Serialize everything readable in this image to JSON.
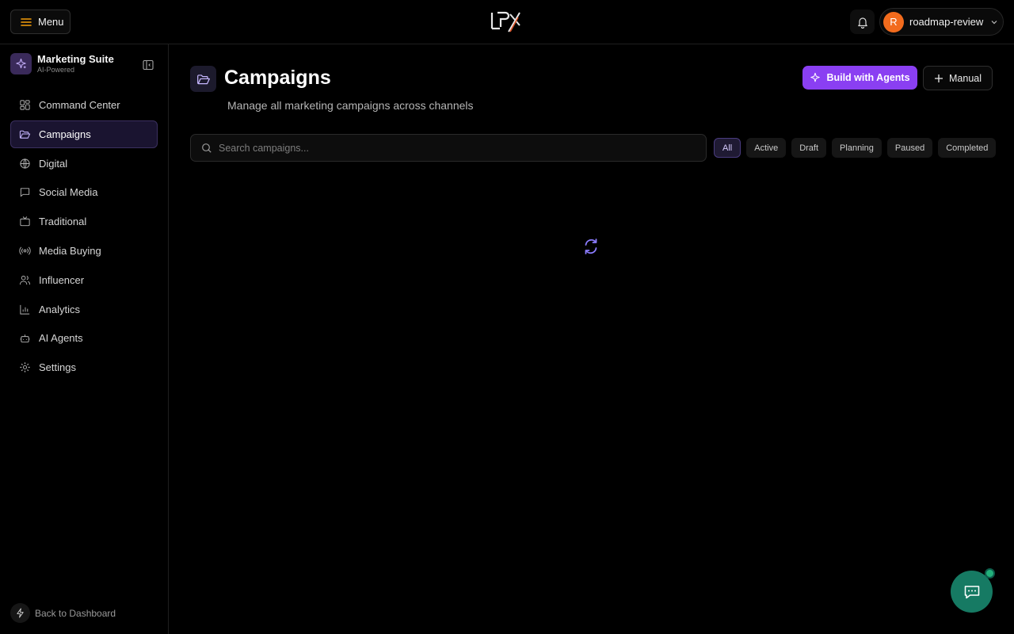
{
  "topbar": {
    "menu_label": "Menu",
    "username": "roadmap-review",
    "avatar_initial": "R"
  },
  "sidebar": {
    "brand_title": "Marketing Suite",
    "brand_subtitle": "AI-Powered",
    "items": [
      {
        "label": "Command Center",
        "icon": "grid-icon",
        "active": false
      },
      {
        "label": "Campaigns",
        "icon": "folder-icon",
        "active": true
      },
      {
        "label": "Digital",
        "icon": "globe-icon",
        "active": false
      },
      {
        "label": "Social Media",
        "icon": "message-icon",
        "active": false
      },
      {
        "label": "Traditional",
        "icon": "tv-icon",
        "active": false
      },
      {
        "label": "Media Buying",
        "icon": "broadcast-icon",
        "active": false
      },
      {
        "label": "Influencer",
        "icon": "users-icon",
        "active": false
      },
      {
        "label": "Analytics",
        "icon": "bar-chart-icon",
        "active": false
      },
      {
        "label": "AI Agents",
        "icon": "bot-icon",
        "active": false
      },
      {
        "label": "Settings",
        "icon": "gear-icon",
        "active": false
      }
    ],
    "back_label": "Back to Dashboard"
  },
  "main": {
    "title": "Campaigns",
    "subtitle": "Manage all marketing campaigns across channels",
    "build_label": "Build with Agents",
    "manual_label": "Manual",
    "search_placeholder": "Search campaigns...",
    "filters": [
      {
        "label": "All",
        "active": true
      },
      {
        "label": "Active",
        "active": false
      },
      {
        "label": "Draft",
        "active": false
      },
      {
        "label": "Planning",
        "active": false
      },
      {
        "label": "Paused",
        "active": false
      },
      {
        "label": "Completed",
        "active": false
      }
    ]
  },
  "colors": {
    "accent": "#8a3ff2",
    "chat_fab": "#167a63",
    "avatar": "#f26b1d"
  }
}
